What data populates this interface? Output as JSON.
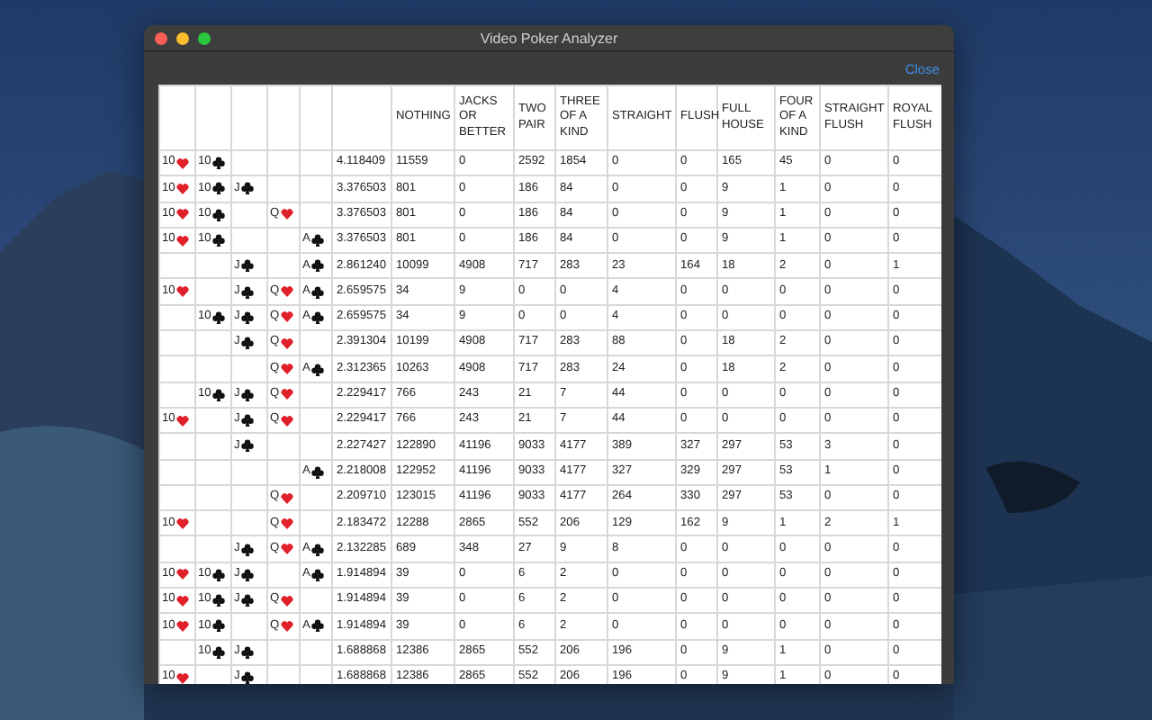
{
  "window": {
    "title": "Video Poker Analyzer"
  },
  "toolbar": {
    "close_label": "Close"
  },
  "table": {
    "columns": [
      "NOTHING",
      "JACKS OR BETTER",
      "TWO PAIR",
      "THREE OF A KIND",
      "STRAIGHT",
      "FLUSH",
      "FULL HOUSE",
      "FOUR OF A KIND",
      "STRAIGHT FLUSH",
      "ROYAL FLUSH"
    ],
    "rows": [
      {
        "slot_1": {
          "rank": "10",
          "kind": "heart"
        },
        "slot_2": {
          "rank": "10",
          "kind": "club"
        },
        "ev": "4.118409",
        "counts": [
          "11559",
          "0",
          "2592",
          "1854",
          "0",
          "0",
          "165",
          "45",
          "0",
          "0"
        ]
      },
      {
        "slot_1": {
          "rank": "10",
          "kind": "heart"
        },
        "slot_2": {
          "rank": "10",
          "kind": "club"
        },
        "slot_3": {
          "rank": "J",
          "kind": "club"
        },
        "ev": "3.376503",
        "counts": [
          "801",
          "0",
          "186",
          "84",
          "0",
          "0",
          "9",
          "1",
          "0",
          "0"
        ]
      },
      {
        "slot_1": {
          "rank": "10",
          "kind": "heart"
        },
        "slot_2": {
          "rank": "10",
          "kind": "club"
        },
        "slot_4": {
          "rank": "Q",
          "kind": "heart"
        },
        "ev": "3.376503",
        "counts": [
          "801",
          "0",
          "186",
          "84",
          "0",
          "0",
          "9",
          "1",
          "0",
          "0"
        ]
      },
      {
        "slot_1": {
          "rank": "10",
          "kind": "heart"
        },
        "slot_2": {
          "rank": "10",
          "kind": "club"
        },
        "slot_5": {
          "rank": "A",
          "kind": "club"
        },
        "ev": "3.376503",
        "counts": [
          "801",
          "0",
          "186",
          "84",
          "0",
          "0",
          "9",
          "1",
          "0",
          "0"
        ]
      },
      {
        "slot_3": {
          "rank": "J",
          "kind": "club"
        },
        "slot_5": {
          "rank": "A",
          "kind": "club"
        },
        "ev": "2.861240",
        "counts": [
          "10099",
          "4908",
          "717",
          "283",
          "23",
          "164",
          "18",
          "2",
          "0",
          "1"
        ]
      },
      {
        "slot_1": {
          "rank": "10",
          "kind": "heart"
        },
        "slot_3": {
          "rank": "J",
          "kind": "club"
        },
        "slot_4": {
          "rank": "Q",
          "kind": "heart"
        },
        "slot_5": {
          "rank": "A",
          "kind": "club"
        },
        "ev": "2.659575",
        "counts": [
          "34",
          "9",
          "0",
          "0",
          "4",
          "0",
          "0",
          "0",
          "0",
          "0"
        ]
      },
      {
        "slot_2": {
          "rank": "10",
          "kind": "club"
        },
        "slot_3": {
          "rank": "J",
          "kind": "club"
        },
        "slot_4": {
          "rank": "Q",
          "kind": "heart"
        },
        "slot_5": {
          "rank": "A",
          "kind": "club"
        },
        "ev": "2.659575",
        "counts": [
          "34",
          "9",
          "0",
          "0",
          "4",
          "0",
          "0",
          "0",
          "0",
          "0"
        ]
      },
      {
        "slot_3": {
          "rank": "J",
          "kind": "club"
        },
        "slot_4": {
          "rank": "Q",
          "kind": "heart"
        },
        "ev": "2.391304",
        "counts": [
          "10199",
          "4908",
          "717",
          "283",
          "88",
          "0",
          "18",
          "2",
          "0",
          "0"
        ]
      },
      {
        "slot_4": {
          "rank": "Q",
          "kind": "heart"
        },
        "slot_5": {
          "rank": "A",
          "kind": "club"
        },
        "ev": "2.312365",
        "counts": [
          "10263",
          "4908",
          "717",
          "283",
          "24",
          "0",
          "18",
          "2",
          "0",
          "0"
        ]
      },
      {
        "slot_2": {
          "rank": "10",
          "kind": "club"
        },
        "slot_3": {
          "rank": "J",
          "kind": "club"
        },
        "slot_4": {
          "rank": "Q",
          "kind": "heart"
        },
        "ev": "2.229417",
        "counts": [
          "766",
          "243",
          "21",
          "7",
          "44",
          "0",
          "0",
          "0",
          "0",
          "0"
        ]
      },
      {
        "slot_1": {
          "rank": "10",
          "kind": "heart"
        },
        "slot_3": {
          "rank": "J",
          "kind": "club"
        },
        "slot_4": {
          "rank": "Q",
          "kind": "heart"
        },
        "ev": "2.229417",
        "counts": [
          "766",
          "243",
          "21",
          "7",
          "44",
          "0",
          "0",
          "0",
          "0",
          "0"
        ]
      },
      {
        "slot_3": {
          "rank": "J",
          "kind": "club"
        },
        "ev": "2.227427",
        "counts": [
          "122890",
          "41196",
          "9033",
          "4177",
          "389",
          "327",
          "297",
          "53",
          "3",
          "0"
        ]
      },
      {
        "slot_5": {
          "rank": "A",
          "kind": "club"
        },
        "ev": "2.218008",
        "counts": [
          "122952",
          "41196",
          "9033",
          "4177",
          "327",
          "329",
          "297",
          "53",
          "1",
          "0"
        ]
      },
      {
        "slot_4": {
          "rank": "Q",
          "kind": "heart"
        },
        "ev": "2.209710",
        "counts": [
          "123015",
          "41196",
          "9033",
          "4177",
          "264",
          "330",
          "297",
          "53",
          "0",
          "0"
        ]
      },
      {
        "slot_1": {
          "rank": "10",
          "kind": "heart"
        },
        "slot_4": {
          "rank": "Q",
          "kind": "heart"
        },
        "ev": "2.183472",
        "counts": [
          "12288",
          "2865",
          "552",
          "206",
          "129",
          "162",
          "9",
          "1",
          "2",
          "1"
        ]
      },
      {
        "slot_3": {
          "rank": "J",
          "kind": "club"
        },
        "slot_4": {
          "rank": "Q",
          "kind": "heart"
        },
        "slot_5": {
          "rank": "A",
          "kind": "club"
        },
        "ev": "2.132285",
        "counts": [
          "689",
          "348",
          "27",
          "9",
          "8",
          "0",
          "0",
          "0",
          "0",
          "0"
        ]
      },
      {
        "slot_1": {
          "rank": "10",
          "kind": "heart"
        },
        "slot_2": {
          "rank": "10",
          "kind": "club"
        },
        "slot_3": {
          "rank": "J",
          "kind": "club"
        },
        "slot_5": {
          "rank": "A",
          "kind": "club"
        },
        "ev": "1.914894",
        "counts": [
          "39",
          "0",
          "6",
          "2",
          "0",
          "0",
          "0",
          "0",
          "0",
          "0"
        ]
      },
      {
        "slot_1": {
          "rank": "10",
          "kind": "heart"
        },
        "slot_2": {
          "rank": "10",
          "kind": "club"
        },
        "slot_3": {
          "rank": "J",
          "kind": "club"
        },
        "slot_4": {
          "rank": "Q",
          "kind": "heart"
        },
        "ev": "1.914894",
        "counts": [
          "39",
          "0",
          "6",
          "2",
          "0",
          "0",
          "0",
          "0",
          "0",
          "0"
        ]
      },
      {
        "slot_1": {
          "rank": "10",
          "kind": "heart"
        },
        "slot_2": {
          "rank": "10",
          "kind": "club"
        },
        "slot_4": {
          "rank": "Q",
          "kind": "heart"
        },
        "slot_5": {
          "rank": "A",
          "kind": "club"
        },
        "ev": "1.914894",
        "counts": [
          "39",
          "0",
          "6",
          "2",
          "0",
          "0",
          "0",
          "0",
          "0",
          "0"
        ]
      },
      {
        "slot_2": {
          "rank": "10",
          "kind": "club"
        },
        "slot_3": {
          "rank": "J",
          "kind": "club"
        },
        "ev": "1.688868",
        "counts": [
          "12386",
          "2865",
          "552",
          "206",
          "196",
          "0",
          "9",
          "1",
          "0",
          "0"
        ]
      },
      {
        "slot_1": {
          "rank": "10",
          "kind": "heart"
        },
        "slot_3": {
          "rank": "J",
          "kind": "club"
        },
        "ev": "1.688868",
        "counts": [
          "12386",
          "2865",
          "552",
          "206",
          "196",
          "0",
          "9",
          "1",
          "0",
          "0"
        ]
      }
    ]
  }
}
